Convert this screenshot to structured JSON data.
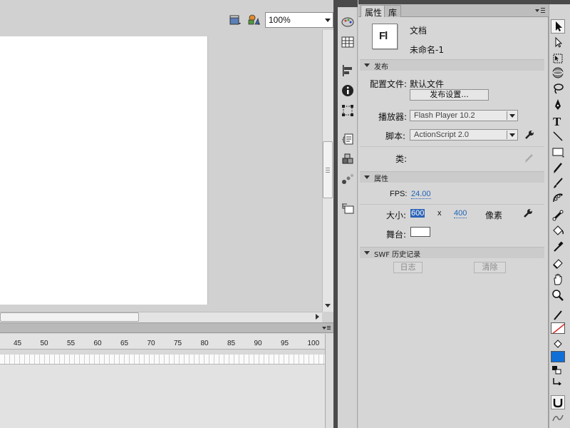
{
  "stage": {
    "zoom_value": "100%"
  },
  "timeline": {
    "ticks": [
      "45",
      "50",
      "55",
      "60",
      "65",
      "70",
      "75",
      "80",
      "85",
      "90",
      "95",
      "100"
    ]
  },
  "panel": {
    "tabs": [
      "属性",
      "库"
    ],
    "doc_type": "文档",
    "doc_name": "未命名-1",
    "doc_icon_text": "Fl",
    "publish": {
      "header": "发布",
      "profile_label": "配置文件:",
      "profile_value": "默认文件",
      "settings_button": "发布设置...",
      "player_label": "播放器:",
      "player_value": "Flash Player 10.2",
      "script_label": "脚本:",
      "script_value": "ActionScript 2.0",
      "class_label": "类:"
    },
    "properties": {
      "header": "属性",
      "fps_label": "FPS:",
      "fps_value": "24.00",
      "size_label": "大小:",
      "width": "600",
      "x_sep": "x",
      "height": "400",
      "unit": "像素",
      "stage_label": "舞台:",
      "stage_color": "#ffffff"
    },
    "swf_history": {
      "header": "SWF 历史记录",
      "log_button": "日志",
      "clear_button": "清除"
    }
  },
  "colors": {
    "stroke_color": "#ffffff",
    "fill_color": "#0f6fd6",
    "accent_link": "#1d63b8"
  }
}
